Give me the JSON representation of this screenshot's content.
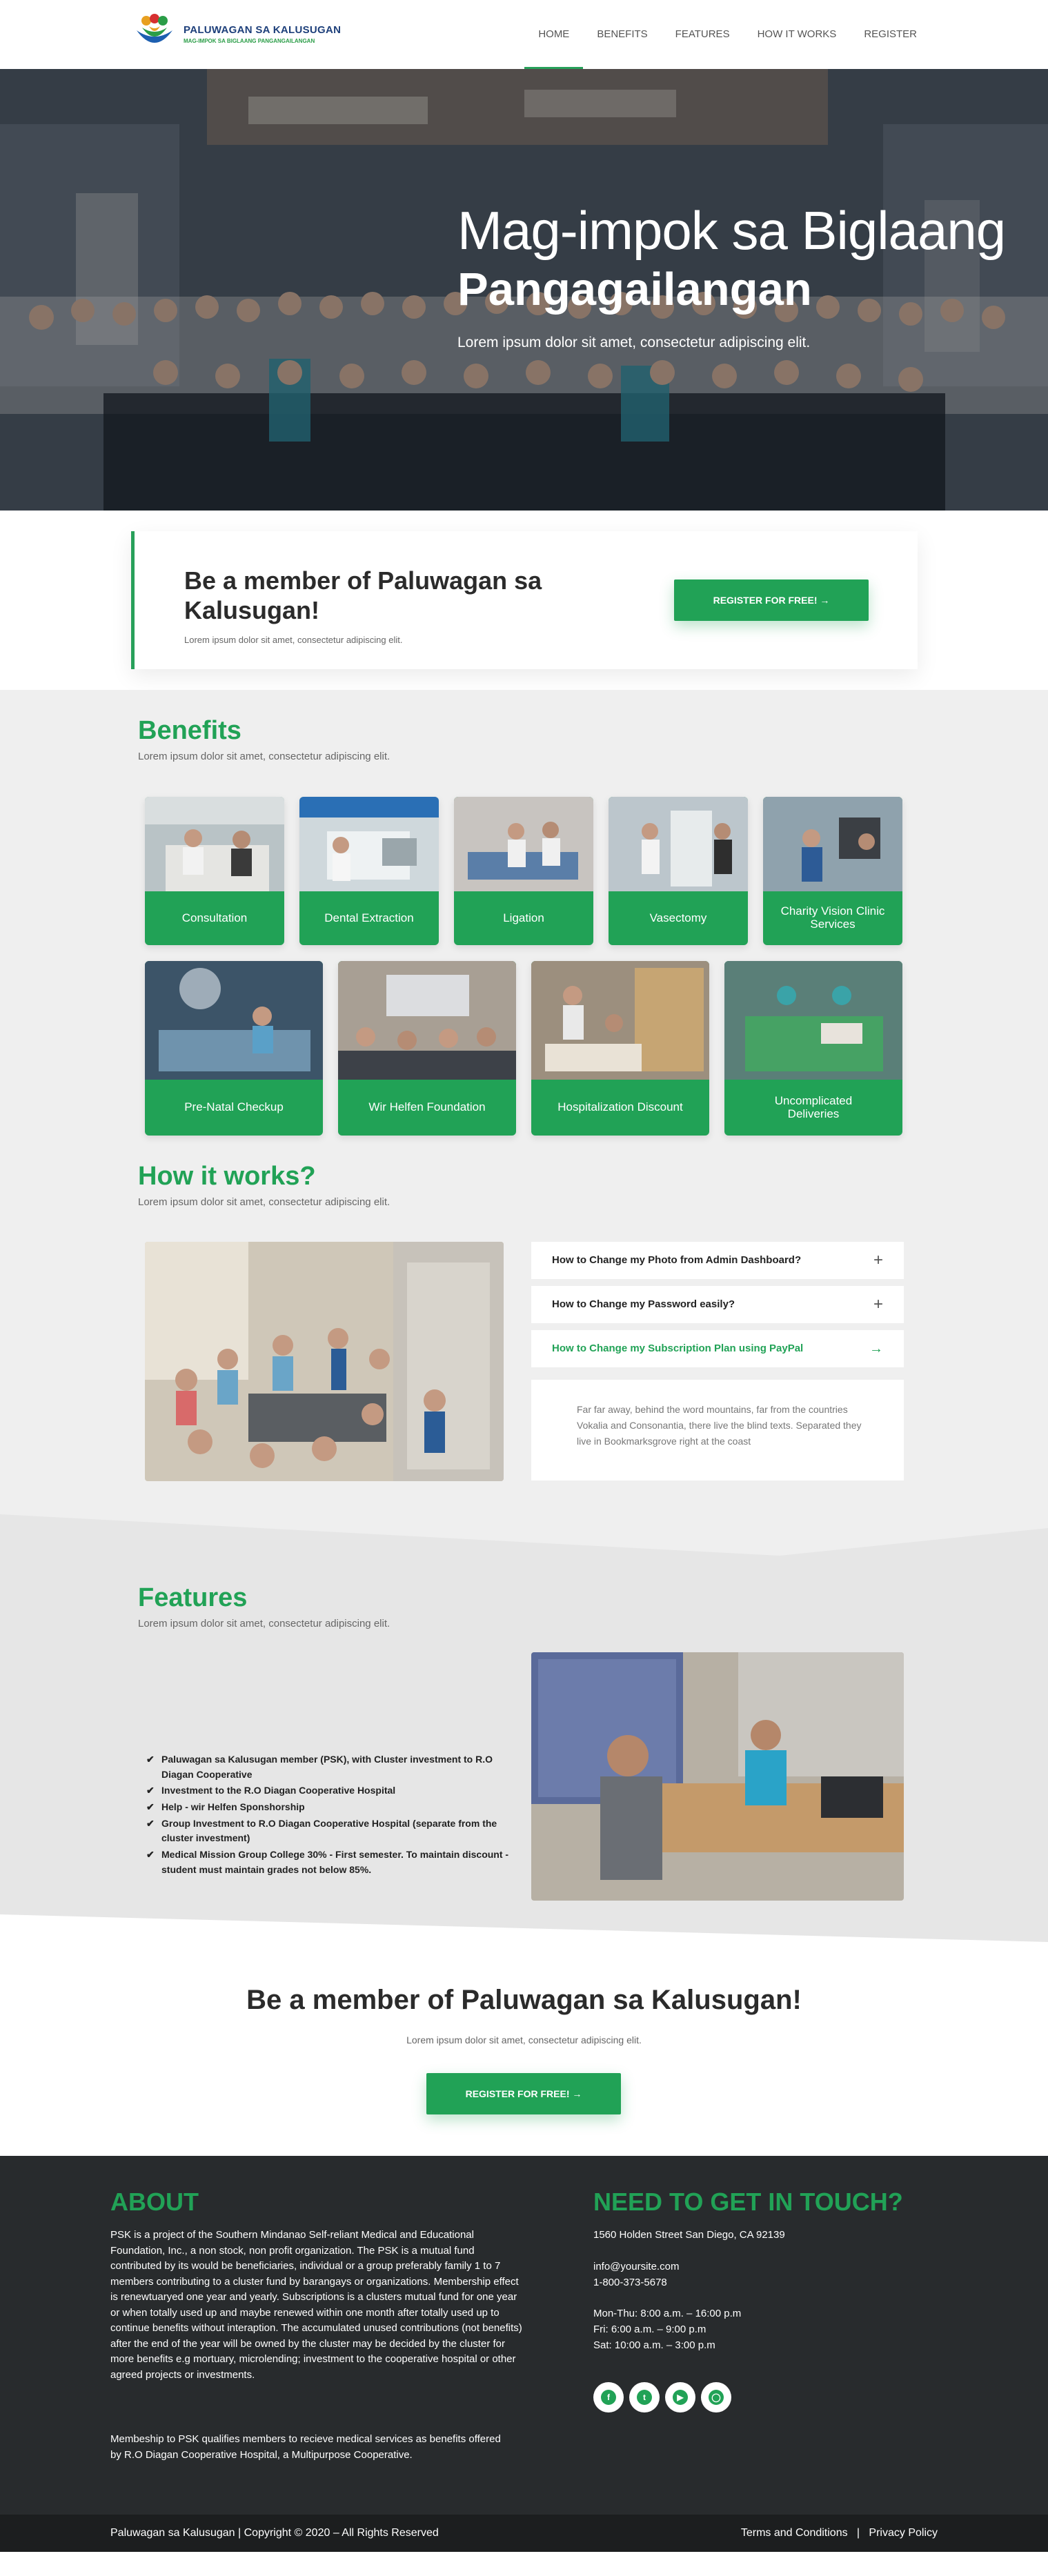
{
  "header": {
    "logo_title": "PALUWAGAN SA KALUSUGAN",
    "logo_tagline": "MAG-IMPOK SA BIGLAANG PANGANGAILANGAN",
    "nav": [
      "HOME",
      "BENEFITS",
      "FEATURES",
      "HOW IT WORKS",
      "REGISTER"
    ],
    "active_nav": "HOME"
  },
  "hero": {
    "title_line1": "Mag-impok sa Biglaang",
    "title_line2": "Pangagailangan",
    "subtitle": "Lorem ipsum dolor sit amet, consectetur adipiscing elit."
  },
  "cta_top": {
    "title": "Be a member of Paluwagan sa Kalusugan!",
    "subtitle": "Lorem ipsum dolor sit amet, consectetur adipiscing elit.",
    "button": "REGISTER FOR FREE! →"
  },
  "benefits": {
    "title": "Benefits",
    "subtitle": "Lorem ipsum dolor sit amet, consectetur adipiscing elit.",
    "row1": [
      "Consultation",
      "Dental Extraction",
      "Ligation",
      "Vasectomy",
      "Charity Vision Clinic Services"
    ],
    "row2": [
      "Pre-Natal Checkup",
      "Wir Helfen Foundation",
      "Hospitalization Discount",
      "Uncomplicated Deliveries"
    ]
  },
  "how": {
    "title": "How it works?",
    "subtitle": "Lorem ipsum dolor sit amet, consectetur adipiscing elit.",
    "faq": [
      {
        "q": "How to Change my Photo from Admin Dashboard?",
        "icon": "+"
      },
      {
        "q": "How to Change my Password easily?",
        "icon": "+"
      },
      {
        "q": "How to Change my Subscription Plan using PayPal",
        "icon": "→"
      }
    ],
    "answer": "Far far away, behind the word mountains, far from the countries Vokalia and Consonantia, there live the blind texts. Separated they live in Bookmarksgrove right at the coast"
  },
  "features": {
    "title": "Features",
    "subtitle": "Lorem ipsum dolor sit amet, consectetur adipiscing elit.",
    "items": [
      "Paluwagan sa Kalusugan member (PSK), with Cluster investment to R.O Diagan Cooperative",
      "Investment to the R.O Diagan Cooperative Hospital",
      "Help - wir Helfen Sponshorship",
      "Group Investment to R.O Diagan Cooperative Hospital (separate from the cluster investment)",
      "Medical Mission Group College 30% - First semester. To maintain discount - student must maintain grades not below 85%."
    ]
  },
  "cta_bottom": {
    "title": "Be a member of Paluwagan sa Kalusugan!",
    "subtitle": "Lorem ipsum dolor sit amet, consectetur adipiscing elit.",
    "button": "REGISTER FOR FREE! →"
  },
  "footer": {
    "about_title": "ABOUT",
    "about_text": "PSK is a project of the Southern Mindanao Self-reliant Medical and Educational Foundation, Inc., a non stock, non profit organization. The PSK is a mutual fund contributed by its would be beneficiaries, individual or a group preferably family 1 to 7 members contributing to a cluster fund by barangays or organizations. Membership effect is renewtuaryed one year and yearly. Subscriptions is a clusters mutual fund for one year or when totally used up and maybe renewed within one month after totally used up to continue benefits without interaption. The accumulated unused contributions (not benefits) after the end of the year will be owned by the cluster may be decided by the cluster for more benefits e.g mortuary, microlending; investment to the cooperative hospital or other agreed projects or investments.",
    "about_text2": "Membeship to PSK qualifies members to recieve medical services as benefits offered by R.O Diagan Cooperative Hospital, a Multipurpose Cooperative.",
    "contact_title": "NEED TO GET IN TOUCH?",
    "address": "1560 Holden Street San Diego, CA 92139",
    "email": "info@yoursite.com",
    "phone": "1-800-373-5678",
    "hours1": "Mon-Thu: 8:00 a.m. – 16:00 p.m",
    "hours2": "Fri: 6:00 a.m. – 9:00 p.m",
    "hours3": "Sat: 10:00 a.m. – 3:00 p.m",
    "social": [
      "facebook-icon",
      "twitter-icon",
      "youtube-icon",
      "instagram-icon"
    ]
  },
  "copyright": {
    "left": "Paluwagan sa Kalusugan | Copyright © 2020 – All Rights Reserved",
    "terms": "Terms and Conditions",
    "privacy": "Privacy Policy"
  }
}
